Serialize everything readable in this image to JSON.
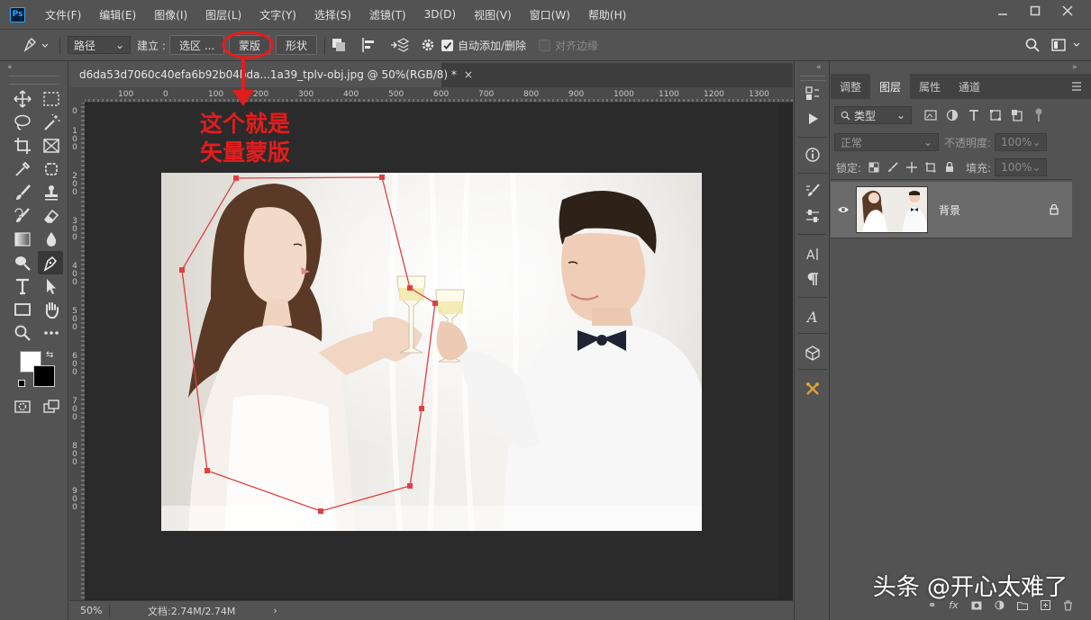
{
  "app": {
    "logo": "Ps"
  },
  "menu": [
    "文件(F)",
    "编辑(E)",
    "图像(I)",
    "图层(L)",
    "文字(Y)",
    "选择(S)",
    "滤镜(T)",
    "3D(D)",
    "视图(V)",
    "窗口(W)",
    "帮助(H)"
  ],
  "options": {
    "mode_value": "路径",
    "make_label": "建立 :",
    "selection_label": "选区 ...",
    "mask_label": "蒙版",
    "shape_label": "形状",
    "auto_add_label": "自动添加/删除",
    "align_edges_label": "对齐边缘"
  },
  "document": {
    "tab_title": "d6da53d7060c40efa6b92b04bda...1a39_tplv-obj.jpg @ 50%(RGB/8) *",
    "zoom": "50%",
    "doc_size": "文档:2.74M/2.74M"
  },
  "ruler": {
    "h_labels": [
      "100",
      "0",
      "100",
      "200",
      "300",
      "400",
      "500",
      "600",
      "700",
      "800",
      "900",
      "1000",
      "1100",
      "1200",
      "1300"
    ],
    "v_labels": [
      "0",
      "1\n0\n0",
      "2\n0\n0",
      "3\n0\n0",
      "4\n0\n0",
      "5\n0\n0",
      "6\n0\n0",
      "7\n0\n0",
      "8\n0\n0",
      "9\n0\n0"
    ]
  },
  "annotation": {
    "line1": "这个就是",
    "line2": "矢量蒙版"
  },
  "layers_panel": {
    "tabs": [
      "调整",
      "图层",
      "属性",
      "通道"
    ],
    "active_tab": "图层",
    "filter_label": "类型",
    "blend_mode": "正常",
    "opacity_label": "不透明度:",
    "opacity_value": "100%",
    "lock_label": "锁定:",
    "fill_label": "填充:",
    "fill_value": "100%",
    "layer_name": "背景"
  },
  "watermark": "头条 @开心太难了",
  "colors": {
    "accent_red": "#e21d1d",
    "path_red": "#e04040",
    "ps_blue": "#31a8ff"
  }
}
